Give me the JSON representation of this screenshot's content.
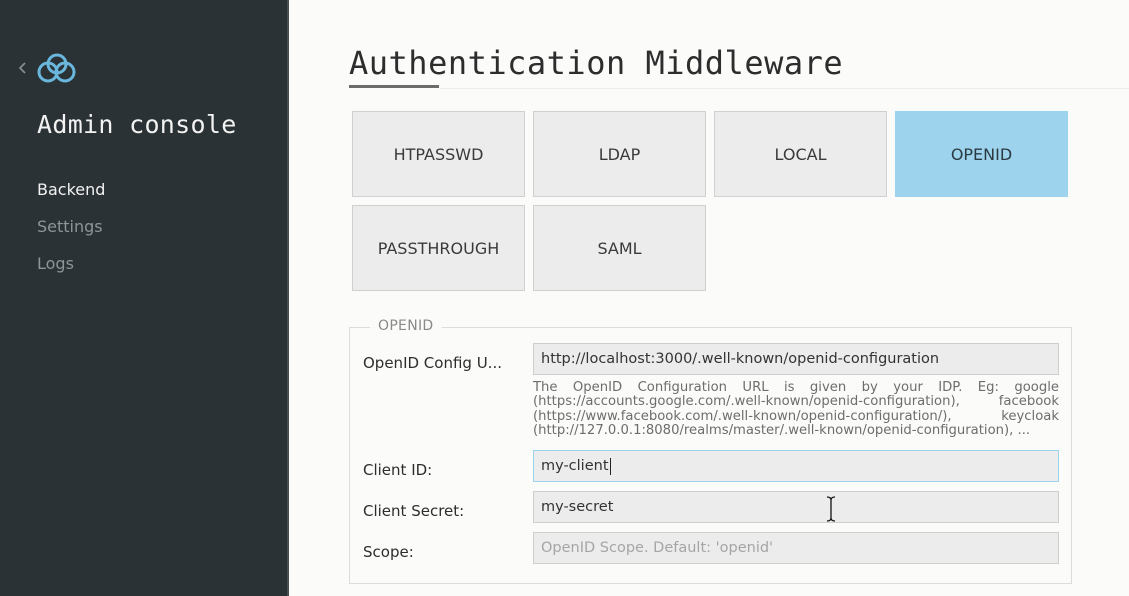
{
  "sidebar": {
    "title": "Admin console",
    "nav": [
      {
        "label": "Backend",
        "active": true
      },
      {
        "label": "Settings",
        "active": false
      },
      {
        "label": "Logs",
        "active": false
      }
    ]
  },
  "main": {
    "title": "Authentication Middleware",
    "tiles": [
      {
        "label": "HTPASSWD",
        "selected": false
      },
      {
        "label": "LDAP",
        "selected": false
      },
      {
        "label": "LOCAL",
        "selected": false
      },
      {
        "label": "OPENID",
        "selected": true
      },
      {
        "label": "PASSTHROUGH",
        "selected": false
      },
      {
        "label": "SAML",
        "selected": false
      }
    ],
    "form": {
      "legend": "OPENID",
      "config_url": {
        "label": "OpenID Config U...",
        "value": "http://localhost:3000/.well-known/openid-configuration",
        "help": "The OpenID Configuration URL is given by your IDP. Eg: google (https://accounts.google.com/.well-known/openid-configuration), facebook (https://www.facebook.com/.well-known/openid-configuration/), keycloak (http://127.0.0.1:8080/realms/master/.well-known/openid-configuration), ..."
      },
      "client_id": {
        "label": "Client ID:",
        "value": "my-client"
      },
      "client_secret": {
        "label": "Client Secret:",
        "value": "my-secret"
      },
      "scope": {
        "label": "Scope:",
        "value": "",
        "placeholder": "OpenID Scope. Default: 'openid'"
      }
    }
  },
  "colors": {
    "sidebar_bg": "#2b3235",
    "accent": "#9dd3ec",
    "logo": "#6ab7dd"
  },
  "icons": [
    "chevron-left-icon",
    "cloud-logo-icon",
    "text-cursor-icon"
  ]
}
